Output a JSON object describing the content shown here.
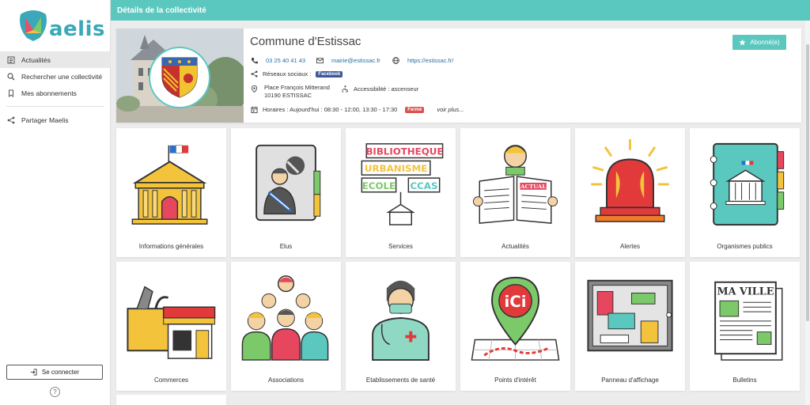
{
  "app": {
    "logo_text": "aelis"
  },
  "sidebar": {
    "items": [
      {
        "label": "Actualités",
        "active": true
      },
      {
        "label": "Rechercher une collectivité"
      },
      {
        "label": "Mes abonnements"
      },
      {
        "label": "Partager Maelis"
      }
    ],
    "connect_label": "Se connecter",
    "help_symbol": "?"
  },
  "header": {
    "title": "Détails de la collectivité"
  },
  "commune": {
    "name": "Commune d'Estissac",
    "follow_label": "Abonné(e)",
    "phone": "03 25 40 41 43",
    "email": "mairie@estissac.fr",
    "website": "https://estissac.fr/",
    "social_label": "Réseaux sociaux :",
    "social_badge": "Facebook",
    "address_line1": "Place François Mitterand",
    "address_line2": "10190 ESTISSAC",
    "accessibility": "Accessibilité : ascenseur",
    "hours": "Horaires : Aujourd'hui : 08:30 - 12:00, 13:30 - 17:30",
    "status_badge": "Fermé",
    "more_label": "voir plus..."
  },
  "tiles": [
    {
      "label": "Informations générales",
      "icon": "town-hall-icon"
    },
    {
      "label": "Elus",
      "icon": "elected-official-icon"
    },
    {
      "label": "Services",
      "icon": "services-signs-icon"
    },
    {
      "label": "Actualités",
      "icon": "newspaper-reader-icon"
    },
    {
      "label": "Alertes",
      "icon": "alarm-light-icon"
    },
    {
      "label": "Organismes publics",
      "icon": "public-bodies-binder-icon"
    },
    {
      "label": "Commerces",
      "icon": "shop-toolbox-icon"
    },
    {
      "label": "Associations",
      "icon": "group-people-icon"
    },
    {
      "label": "Etablissements de santé",
      "icon": "doctor-icon"
    },
    {
      "label": "Points d'intérêt",
      "icon": "map-pin-icon"
    },
    {
      "label": "Panneau d'affichage",
      "icon": "bulletin-board-icon"
    },
    {
      "label": "Bulletins",
      "icon": "magazine-icon"
    }
  ],
  "tile_texts": {
    "bibliotheque": "BIBLIOTHEQUE",
    "urbanisme": "URBANISME",
    "ecole": "ECOLE",
    "ccas": "CCAS",
    "actual": "ACTUAL",
    "ici": "iCi",
    "maville": "MA VILLE"
  },
  "colors": {
    "accent": "#5bc8c0",
    "link": "#2a6f9f",
    "facebook": "#3b5998",
    "closed": "#d9534f"
  }
}
